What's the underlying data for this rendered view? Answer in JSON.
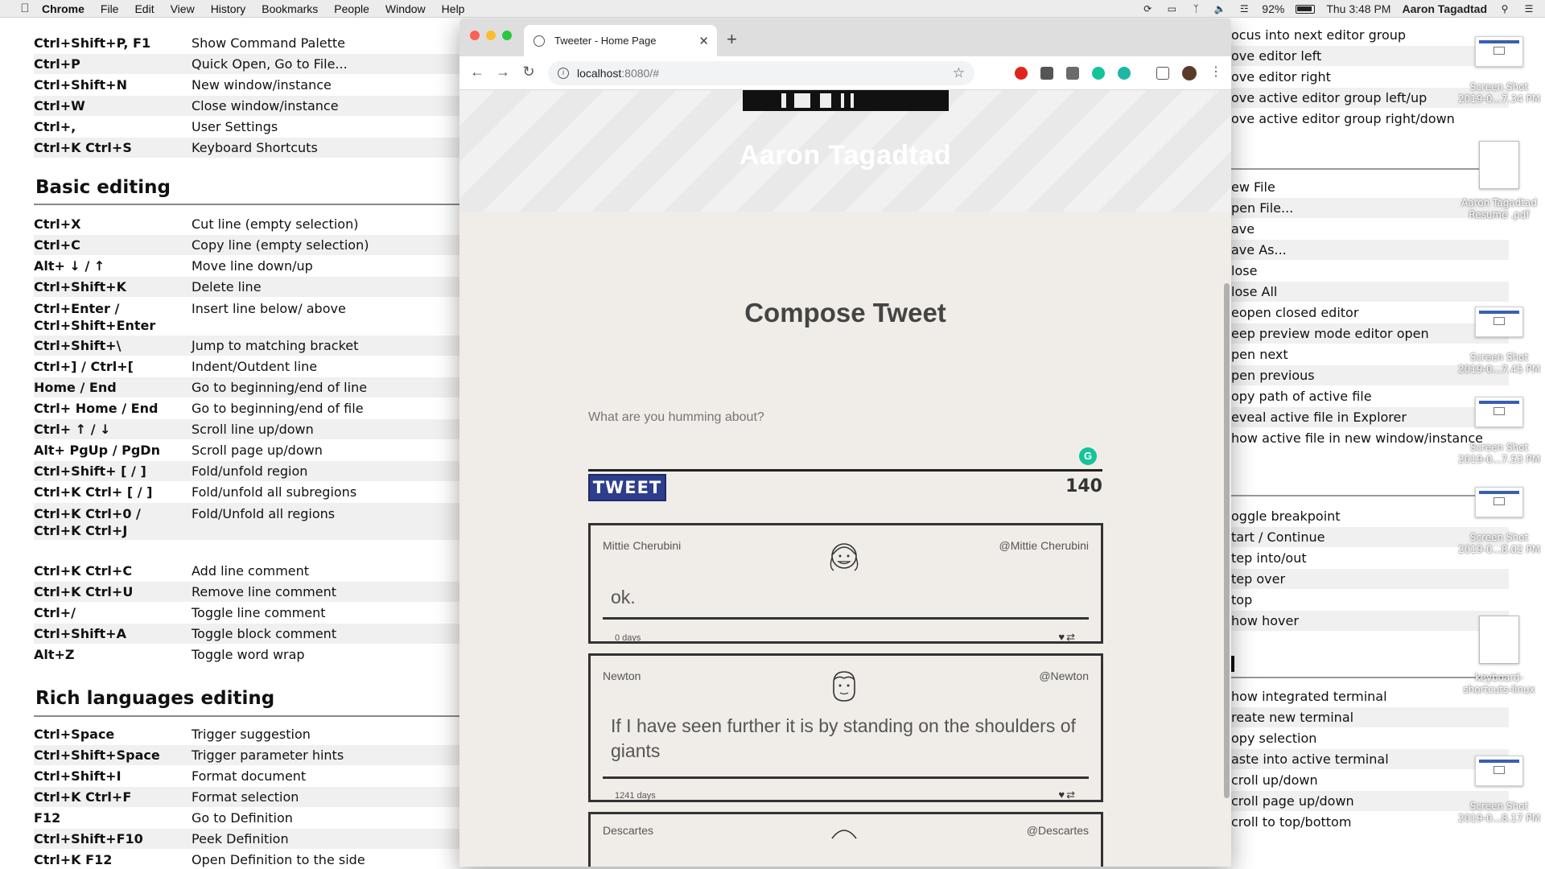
{
  "menubar": {
    "app": "Chrome",
    "items": [
      "File",
      "Edit",
      "View",
      "History",
      "Bookmarks",
      "People",
      "Window",
      "Help"
    ],
    "battery": "92%",
    "clock": "Thu 3:48 PM",
    "user": "Aaron Tagadtad"
  },
  "left_doc": {
    "top_rows": [
      {
        "key": "Ctrl+Shift+P, F1",
        "desc": "Show Command Palette"
      },
      {
        "key": "Ctrl+P",
        "desc": "Quick Open, Go to File..."
      },
      {
        "key": "Ctrl+Shift+N",
        "desc": "New window/instance"
      },
      {
        "key": "Ctrl+W",
        "desc": "Close window/instance"
      },
      {
        "key": "Ctrl+,",
        "desc": "User Settings"
      },
      {
        "key": "Ctrl+K Ctrl+S",
        "desc": "Keyboard Shortcuts"
      }
    ],
    "basic_title": "Basic editing",
    "basic_rows": [
      {
        "key": "Ctrl+X",
        "desc": "Cut line (empty selection)"
      },
      {
        "key": "Ctrl+C",
        "desc": "Copy line (empty selection)"
      },
      {
        "key": "Alt+ ↓ / ↑",
        "desc": "Move line down/up"
      },
      {
        "key": "Ctrl+Shift+K",
        "desc": "Delete line"
      },
      {
        "key": "Ctrl+Enter / Ctrl+Shift+Enter",
        "desc": "Insert line below/ above"
      },
      {
        "key": "Ctrl+Shift+\\",
        "desc": "Jump to matching bracket"
      },
      {
        "key": "Ctrl+] / Ctrl+[",
        "desc": "Indent/Outdent line"
      },
      {
        "key": "Home / End",
        "desc": "Go to beginning/end of line"
      },
      {
        "key": "Ctrl+ Home / End",
        "desc": "Go to beginning/end of file"
      },
      {
        "key": "Ctrl+ ↑ / ↓",
        "desc": "Scroll line up/down"
      },
      {
        "key": "Alt+ PgUp / PgDn",
        "desc": "Scroll page up/down"
      },
      {
        "key": "Ctrl+Shift+ [ / ]",
        "desc": "Fold/unfold region"
      },
      {
        "key": "Ctrl+K Ctrl+ [ / ]",
        "desc": "Fold/unfold all subregions"
      },
      {
        "key": "Ctrl+K Ctrl+0 / Ctrl+K Ctrl+J",
        "desc": "Fold/Unfold all regions"
      },
      {
        "key": "Ctrl+K Ctrl+C",
        "desc": "Add line comment"
      },
      {
        "key": "Ctrl+K Ctrl+U",
        "desc": "Remove line comment"
      },
      {
        "key": "Ctrl+/",
        "desc": "Toggle line comment"
      },
      {
        "key": "Ctrl+Shift+A",
        "desc": "Toggle block comment"
      },
      {
        "key": "Alt+Z",
        "desc": "Toggle word wrap"
      }
    ],
    "rich_title": "Rich languages editing",
    "rich_rows": [
      {
        "key": "Ctrl+Space",
        "desc": "Trigger suggestion"
      },
      {
        "key": "Ctrl+Shift+Space",
        "desc": "Trigger parameter hints"
      },
      {
        "key": "Ctrl+Shift+I",
        "desc": "Format document"
      },
      {
        "key": "Ctrl+K Ctrl+F",
        "desc": "Format selection"
      },
      {
        "key": "F12",
        "desc": "Go to Definition"
      },
      {
        "key": "Ctrl+Shift+F10",
        "desc": "Peek Definition"
      },
      {
        "key": "Ctrl+K F12",
        "desc": "Open Definition to the side"
      }
    ]
  },
  "right_doc": {
    "group1": [
      "ocus into next editor group",
      "ove editor left",
      "ove editor right",
      "ove active editor group left/up",
      "ove active editor group right/down"
    ],
    "group2": [
      "ew File",
      "pen File...",
      "ave",
      "ave As...",
      "lose",
      "lose All",
      "eopen closed editor",
      "eep preview mode editor open",
      "pen next",
      "pen previous",
      "opy path of active file",
      "eveal active file in Explorer",
      "how active file in new window/instance"
    ],
    "group3": [
      "oggle breakpoint",
      "tart / Continue",
      "tep into/out",
      "tep over",
      "top",
      "how hover"
    ],
    "group4": [
      "how integrated terminal",
      "reate new terminal",
      "opy selection",
      "aste into active terminal",
      "croll up/down",
      "croll page up/down",
      "croll to top/bottom"
    ],
    "desktop_labels": [
      "Screen Shot 2019-0...7.34 PM",
      "Aaron Tagadtad Resume .pdf",
      "Screen Shot 2019-0...7.45 PM",
      "Screen Shot 2019-0...7.53 PM",
      "Screen Shot 2019-0...8.02 PM",
      "keyboard-shortcuts-linux",
      "Screen Shot 2019-0...8.17 PM"
    ]
  },
  "browser": {
    "tab_title": "Tweeter - Home Page",
    "url_host": "localhost",
    "url_rest": ":8080/#"
  },
  "page": {
    "hero_name": "Aaron Tagadtad",
    "compose_title": "Compose Tweet",
    "tweet_placeholder": "What are you humming about?",
    "tweet_button": "TWEET",
    "char_count": "140",
    "tweets": [
      {
        "name": "Mittie Cherubini",
        "handle": "@Mittie Cherubini",
        "text": "ok.",
        "age": "0 days"
      },
      {
        "name": "Newton",
        "handle": "@Newton",
        "text": "If I have seen further it is by standing on the shoulders of giants",
        "age": "1241 days"
      },
      {
        "name": "Descartes",
        "handle": "@Descartes",
        "text": "",
        "age": ""
      }
    ]
  },
  "colors": {
    "tweet_button_bg": "#2d3e8c",
    "page_bg": "#f0ede8",
    "hero_bg": "#e9e9e9",
    "grammarly": "#15c39a"
  }
}
